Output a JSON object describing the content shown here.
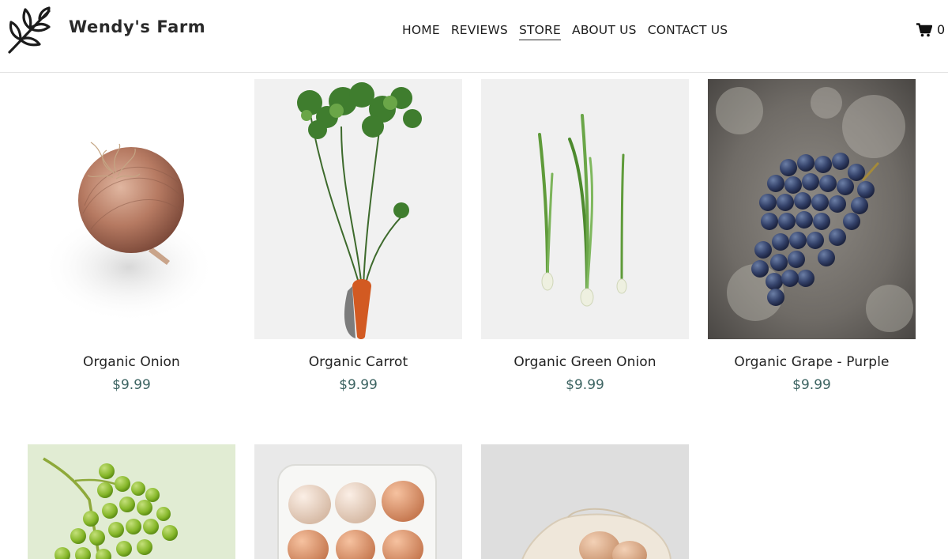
{
  "brand": {
    "name": "Wendy's  Farm",
    "logo_icon": "leaf-sprig-icon"
  },
  "nav": {
    "items": [
      {
        "label": "HOME",
        "active": false
      },
      {
        "label": "REVIEWS",
        "active": false
      },
      {
        "label": "STORE",
        "active": true
      },
      {
        "label": "ABOUT US",
        "active": false
      },
      {
        "label": "CONTACT US",
        "active": false
      }
    ]
  },
  "cart": {
    "icon": "cart-icon",
    "count": "0"
  },
  "colors": {
    "price": "#3d6462",
    "text": "#222222",
    "divider": "#e2e2e2"
  },
  "products": [
    {
      "name": "Organic Onion",
      "price": "$9.99",
      "image": "onion"
    },
    {
      "name": "Organic Carrot",
      "price": "$9.99",
      "image": "carrot"
    },
    {
      "name": "Organic Green Onion",
      "price": "$9.99",
      "image": "green-onion"
    },
    {
      "name": "Organic Grape - Purple",
      "price": "$9.99",
      "image": "purple-grapes"
    },
    {
      "image": "green-grapes"
    },
    {
      "image": "egg-carton"
    },
    {
      "image": "eggs-in-bag"
    }
  ]
}
